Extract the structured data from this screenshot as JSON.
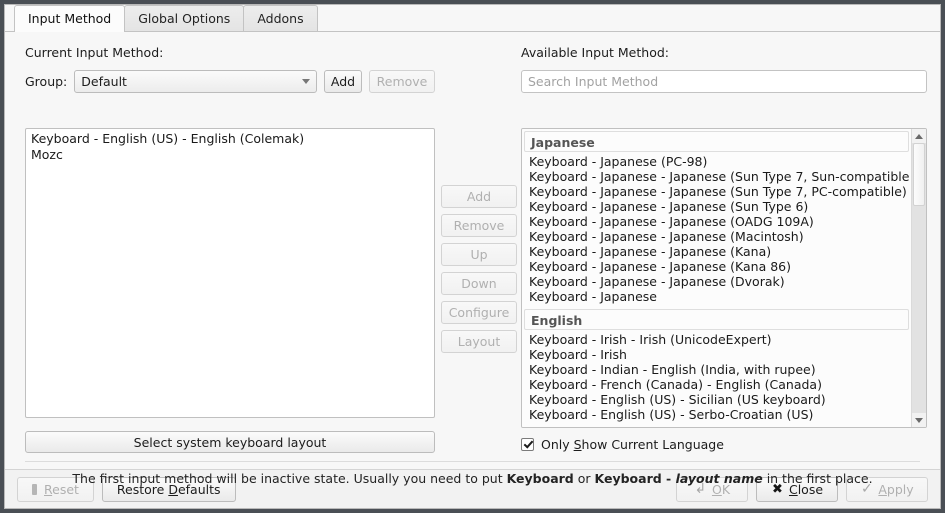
{
  "window": {
    "tabs": [
      {
        "label": "Input Method",
        "active": true
      },
      {
        "label": "Global Options",
        "active": false
      },
      {
        "label": "Addons",
        "active": false
      }
    ]
  },
  "left_panel": {
    "current_label": "Current Input Method:",
    "group_label": "Group:",
    "group_value": "Default",
    "add_button": "Add",
    "remove_button": "Remove",
    "current_methods": [
      "Keyboard - English (US) - English (Colemak)",
      "Mozc"
    ],
    "select_layout_button": "Select system keyboard layout"
  },
  "middle_buttons": [
    {
      "label": "Add",
      "enabled": false
    },
    {
      "label": "Remove",
      "enabled": false
    },
    {
      "label": "Up",
      "enabled": false
    },
    {
      "label": "Down",
      "enabled": false
    },
    {
      "label": "Configure",
      "enabled": false
    },
    {
      "label": "Layout",
      "enabled": false
    }
  ],
  "right_panel": {
    "available_label": "Available Input Method:",
    "search_placeholder": "Search Input Method",
    "search_value": "",
    "groups": [
      {
        "name": "Japanese",
        "items": [
          "Keyboard - Japanese (PC-98)",
          "Keyboard - Japanese - Japanese (Sun Type 7, Sun-compatible)",
          "Keyboard - Japanese - Japanese (Sun Type 7, PC-compatible)",
          "Keyboard - Japanese - Japanese (Sun Type 6)",
          "Keyboard - Japanese - Japanese (OADG 109A)",
          "Keyboard - Japanese - Japanese (Macintosh)",
          "Keyboard - Japanese - Japanese (Kana)",
          "Keyboard - Japanese - Japanese (Kana 86)",
          "Keyboard - Japanese - Japanese (Dvorak)",
          "Keyboard - Japanese"
        ]
      },
      {
        "name": "English",
        "items": [
          "Keyboard - Irish - Irish (UnicodeExpert)",
          "Keyboard - Irish",
          "Keyboard - Indian - English (India, with rupee)",
          "Keyboard - French (Canada) - English (Canada)",
          "Keyboard - English (US) - Sicilian (US keyboard)",
          "Keyboard - English (US) - Serbo-Croatian (US)"
        ]
      }
    ],
    "only_show_current_language": {
      "checked": true,
      "text_before": "Only ",
      "accel": "S",
      "text_after": "how Current Language"
    }
  },
  "hint": {
    "part1": "The first input method will be inactive state. Usually you need to put ",
    "bold1": "Keyboard",
    "part2": " or ",
    "bold2": "Keyboard - ",
    "boldital": "layout name",
    "part3": " in the first place."
  },
  "footer": {
    "reset": {
      "label_before": "",
      "accel": "R",
      "label_after": "eset",
      "full": "Reset",
      "enabled": false,
      "icon": "reset-icon"
    },
    "restore_defaults": {
      "label_before": "Restore ",
      "accel": "D",
      "label_after": "efaults",
      "full": "Restore Defaults",
      "enabled": true
    },
    "ok": {
      "label_before": "",
      "accel": "O",
      "label_after": "K",
      "full": "OK",
      "enabled": false,
      "icon": "enter-arrow-icon"
    },
    "close": {
      "label_before": "",
      "accel": "C",
      "label_after": "lose",
      "full": "Close",
      "enabled": true,
      "icon": "x-icon"
    },
    "apply": {
      "label_before": "",
      "accel": "A",
      "label_after": "pply",
      "full": "Apply",
      "enabled": false,
      "icon": "checkmark-icon"
    }
  },
  "colors": {
    "window_bg": "#f7f7f7",
    "desktop_bg": "#4a4f55",
    "list_bg": "#ffffff",
    "border": "#c0c0c0",
    "disabled_text": "#b0b0b0"
  }
}
